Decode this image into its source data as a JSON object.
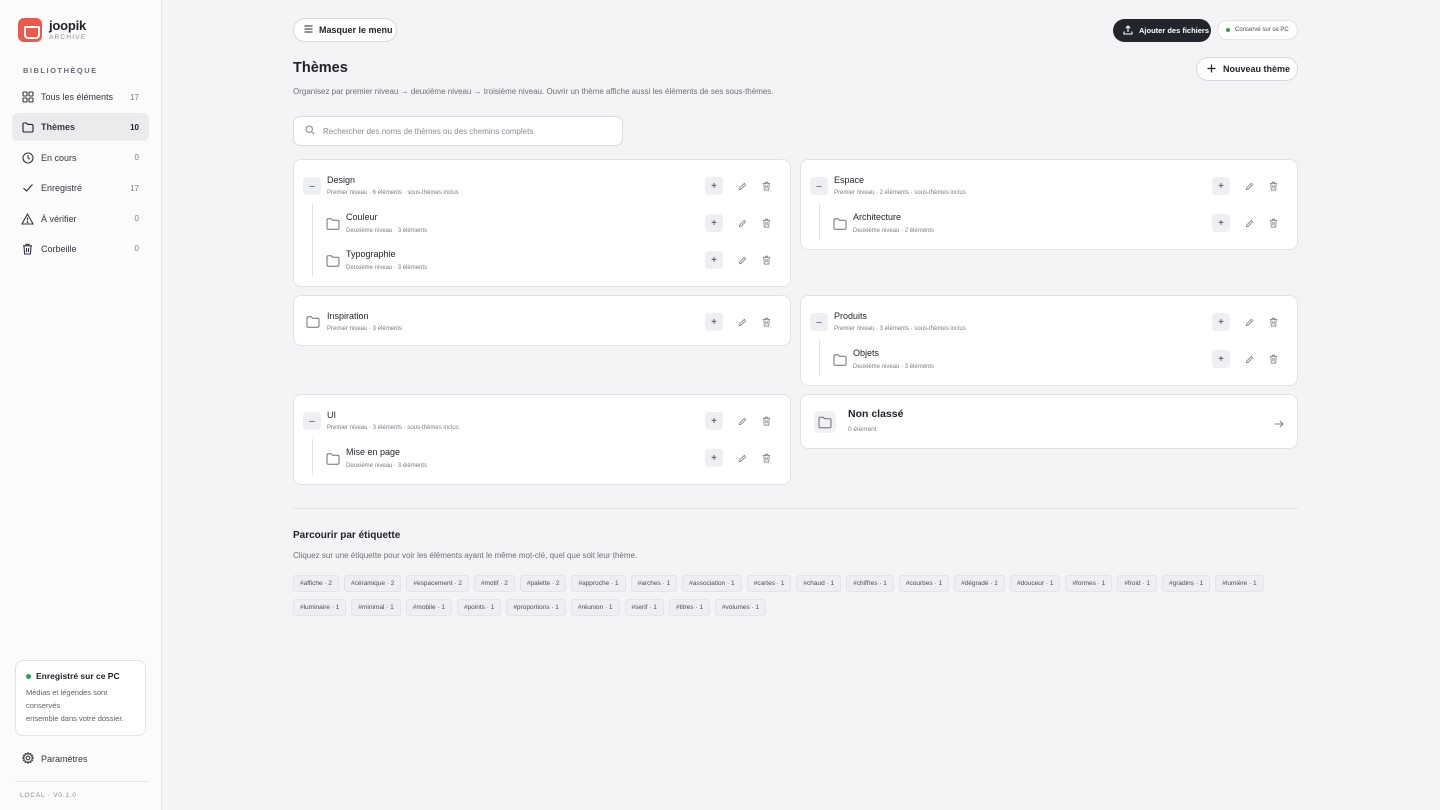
{
  "brand": {
    "name": "joopik",
    "sub": "ARCHIVE"
  },
  "sidebar": {
    "section": "BIBLIOTHÈQUE",
    "items": [
      {
        "label": "Tous les éléments",
        "count": "17",
        "icon": "grid-icon"
      },
      {
        "label": "Thèmes",
        "count": "10",
        "icon": "folder-icon",
        "active": true
      },
      {
        "label": "En cours",
        "count": "0",
        "icon": "clock-icon"
      },
      {
        "label": "Enregistré",
        "count": "17",
        "icon": "check-icon"
      },
      {
        "label": "À vérifier",
        "count": "0",
        "icon": "warning-icon"
      },
      {
        "label": "Corbeille",
        "count": "0",
        "icon": "trash-icon"
      }
    ],
    "save_card": {
      "title": "Enregistré sur ce PC",
      "line1": "Médias et légendes sont",
      "line2": "conservés",
      "line3": "ensemble dans votre dossier."
    },
    "settings": "Paramètres",
    "version": "LOCAL · V0.1.0"
  },
  "toolbar": {
    "menu_label": "Masquer le menu",
    "upload_label": "Ajouter des fichiers",
    "pc_badge": "Conservé sur ce PC",
    "new_theme": "Nouveau thème"
  },
  "page": {
    "title": "Thèmes",
    "description": "Organisez par premier niveau → deuxième niveau → troisième niveau. Ouvrir un thème affiche aussi les éléments de ses sous-thèmes.",
    "search_placeholder": "Rechercher des noms de thèmes ou des chemins complets"
  },
  "themes": {
    "design": {
      "name": "Design",
      "meta": "Premier niveau · 6 éléments · sous-thèmes inclus",
      "children": [
        {
          "name": "Couleur",
          "meta": "Deuxième niveau · 3 éléments"
        },
        {
          "name": "Typographie",
          "meta": "Deuxième niveau · 3 éléments"
        }
      ]
    },
    "espace": {
      "name": "Espace",
      "meta": "Premier niveau · 2 éléments · sous-thèmes inclus",
      "children": [
        {
          "name": "Architecture",
          "meta": "Deuxième niveau · 2 éléments"
        }
      ]
    },
    "inspiration": {
      "name": "Inspiration",
      "meta": "Premier niveau · 3 éléments"
    },
    "produits": {
      "name": "Produits",
      "meta": "Premier niveau · 3 éléments · sous-thèmes inclus",
      "children": [
        {
          "name": "Objets",
          "meta": "Deuxième niveau · 3 éléments"
        }
      ]
    },
    "ui": {
      "name": "UI",
      "meta": "Premier niveau · 3 éléments · sous-thèmes inclus",
      "children": [
        {
          "name": "Mise en page",
          "meta": "Deuxième niveau · 3 éléments"
        }
      ]
    },
    "unclassified": {
      "name": "Non classé",
      "meta": "0 élément"
    }
  },
  "tags_section": {
    "title": "Parcourir par étiquette",
    "description": "Cliquez sur une étiquette pour voir les éléments ayant le même mot-clé, quel que soit leur thème.",
    "tags": [
      "#affiche · 2",
      "#céramique · 2",
      "#espacement · 2",
      "#motif · 2",
      "#palette · 2",
      "#approche · 1",
      "#arches · 1",
      "#association · 1",
      "#cartes · 1",
      "#chaud · 1",
      "#chiffres · 1",
      "#courbes · 1",
      "#dégradé · 1",
      "#douceur · 1",
      "#formes · 1",
      "#froid · 1",
      "#gradins · 1",
      "#lumière · 1",
      "#luminaire · 1",
      "#minimal · 1",
      "#mobile · 1",
      "#points · 1",
      "#proportions · 1",
      "#réunion · 1",
      "#serif · 1",
      "#titres · 1",
      "#volumes · 1"
    ]
  },
  "colors": {
    "accent": "#ec5a4c",
    "dark_button": "#23252c",
    "status_green": "#27a05a"
  }
}
